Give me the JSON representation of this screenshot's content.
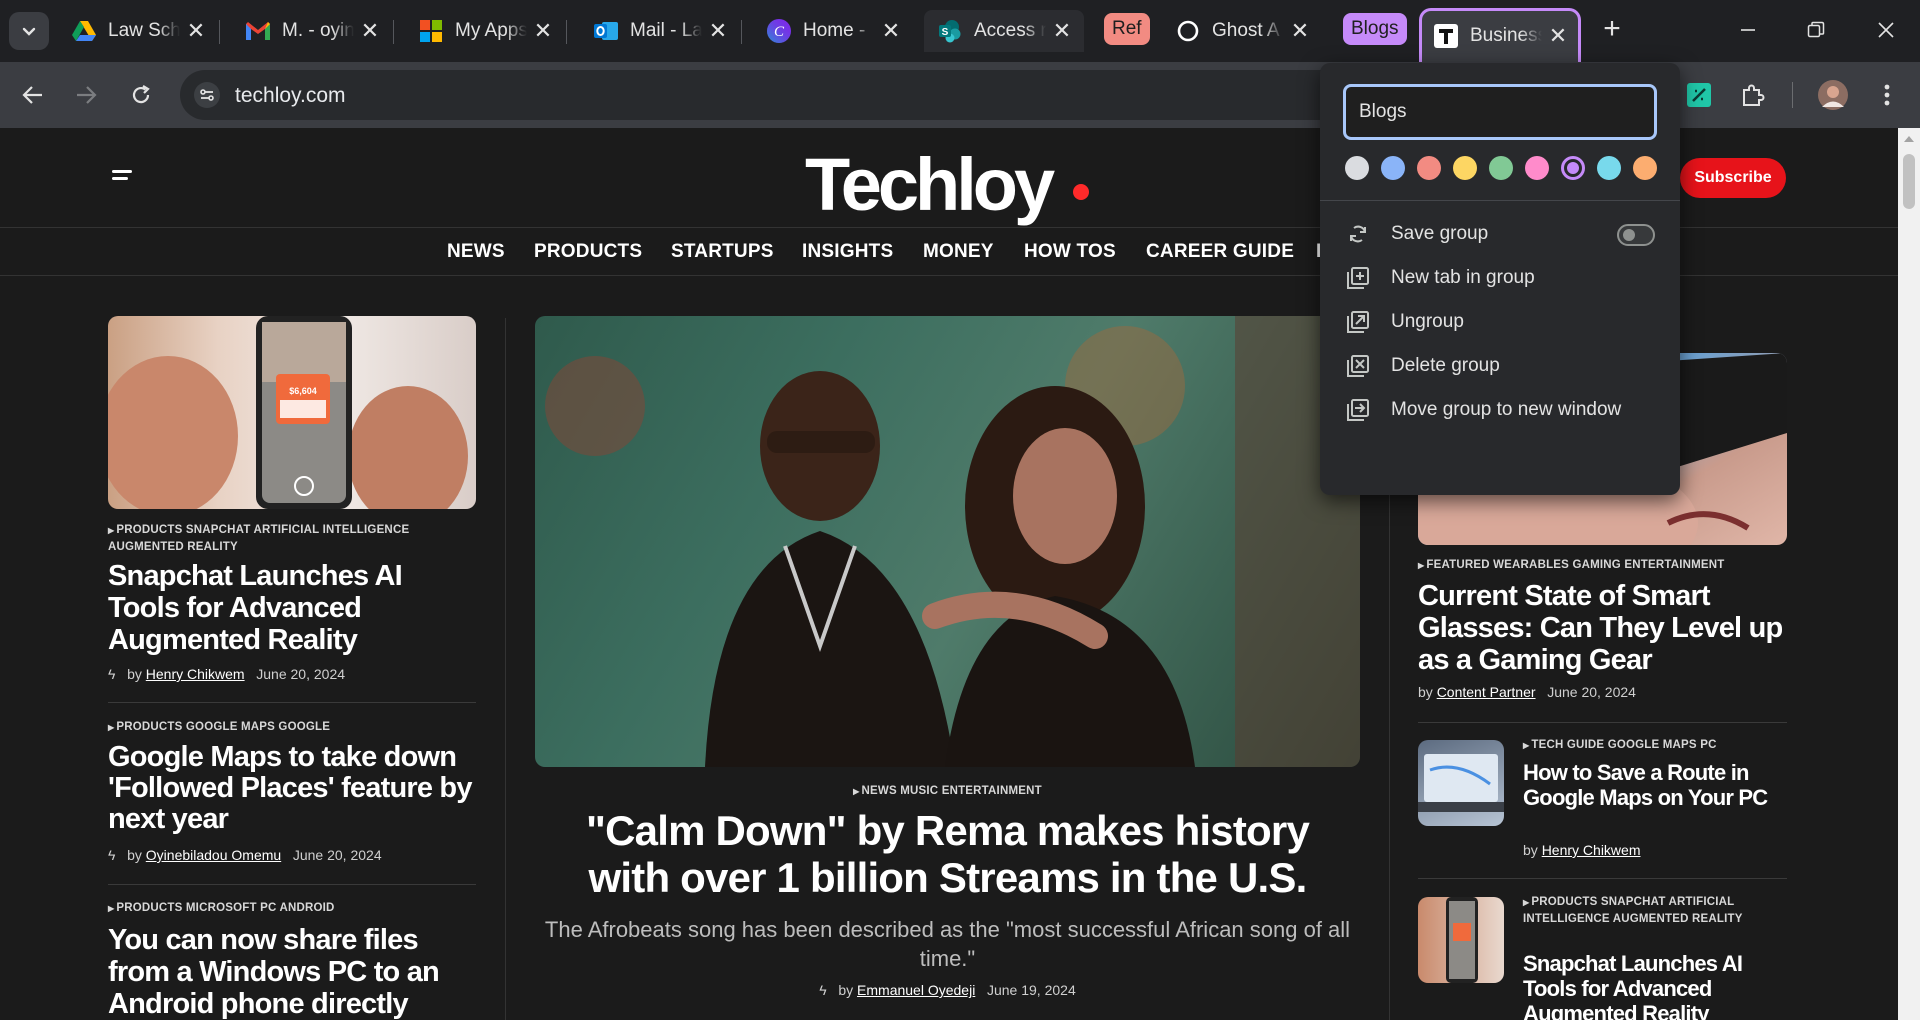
{
  "tabstrip": {
    "tabs": [
      {
        "title": "Law School",
        "favicon": "google-drive-icon"
      },
      {
        "title": "M. - oyin",
        "favicon": "gmail-icon"
      },
      {
        "title": "My Apps",
        "favicon": "microsoft-icon"
      },
      {
        "title": "Mail - La",
        "favicon": "outlook-icon"
      },
      {
        "title": "Home -",
        "favicon": "canva-icon"
      },
      {
        "title": "Access r",
        "favicon": "sharepoint-icon"
      },
      {
        "title": "Ghost A",
        "favicon": "ghost-icon"
      },
      {
        "title": "Business",
        "favicon": "techloy-icon"
      }
    ],
    "groups": [
      {
        "label": "Ref",
        "color": "#f28b82"
      },
      {
        "label": "Blogs",
        "color": "#c58af9"
      }
    ],
    "new_tab": "+"
  },
  "toolbar": {
    "url": "techloy.com"
  },
  "site": {
    "logo": "Techloy",
    "subscribe": "Subscribe",
    "menu": [
      "NEWS",
      "PRODUCTS",
      "STARTUPS",
      "INSIGHTS",
      "MONEY",
      "HOW TOS",
      "CAREER GUIDE",
      "B"
    ],
    "left_articles": [
      {
        "tags": [
          "PRODUCTS",
          "SNAPCHAT",
          "ARTIFICIAL INTELLIGENCE",
          "AUGMENTED REALITY"
        ],
        "title": "Snapchat Launches AI Tools for Advanced Augmented Reality",
        "by": "by",
        "author": "Henry Chikwem",
        "date": "June 20, 2024",
        "price_text": "$6,604"
      },
      {
        "tags": [
          "PRODUCTS",
          "GOOGLE MAPS",
          "GOOGLE"
        ],
        "title": "Google Maps to take down 'Followed Places' feature by next year",
        "by": "by",
        "author": "Oyinebiladou Omemu",
        "date": "June 20, 2024"
      },
      {
        "tags": [
          "PRODUCTS",
          "MICROSOFT",
          "PC",
          "ANDROID"
        ],
        "title": "You can now share files from a Windows PC to an Android phone directly"
      }
    ],
    "feature": {
      "tags": [
        "NEWS",
        "MUSIC",
        "ENTERTAINMENT"
      ],
      "title": "\"Calm Down\" by Rema makes history with over 1 billion Streams in the U.S.",
      "summary": "The Afrobeats song has been described as the \"most successful African song of all time.\"",
      "by": "by",
      "author": "Emmanuel Oyedeji",
      "date": "June 19, 2024"
    },
    "right_articles": [
      {
        "tags": [
          "FEATURED",
          "WEARABLES",
          "GAMING",
          "ENTERTAINMENT"
        ],
        "title": "Current State of Smart Glasses: Can They Level up as a Gaming Gear",
        "by": "by",
        "author": "Content Partner",
        "date": "June 20, 2024"
      },
      {
        "tags": [
          "TECH GUIDE",
          "GOOGLE MAPS",
          "PC"
        ],
        "title": "How to Save a Route in Google Maps on Your PC",
        "by": "by",
        "author": "Henry Chikwem"
      },
      {
        "tags": [
          "PRODUCTS",
          "SNAPCHAT",
          "ARTIFICIAL INTELLIGENCE",
          "AUGMENTED REALITY"
        ],
        "title": "Snapchat Launches AI Tools for Advanced Augmented Reality"
      }
    ]
  },
  "group_popup": {
    "name_value": "Blogs",
    "colors": [
      "#dadce0",
      "#8ab4f8",
      "#f28b82",
      "#fdd663",
      "#81c995",
      "#ff8bcb",
      "#c58af9",
      "#78d9ec",
      "#fcad70"
    ],
    "selected_color": "#c58af9",
    "items": [
      {
        "label": "Save group",
        "icon": "save-group-icon"
      },
      {
        "label": "New tab in group",
        "icon": "new-tab-in-group-icon"
      },
      {
        "label": "Ungroup",
        "icon": "ungroup-icon"
      },
      {
        "label": "Delete group",
        "icon": "delete-group-icon"
      },
      {
        "label": "Move group to new window",
        "icon": "move-to-window-icon"
      }
    ],
    "save_toggle_on": false
  }
}
